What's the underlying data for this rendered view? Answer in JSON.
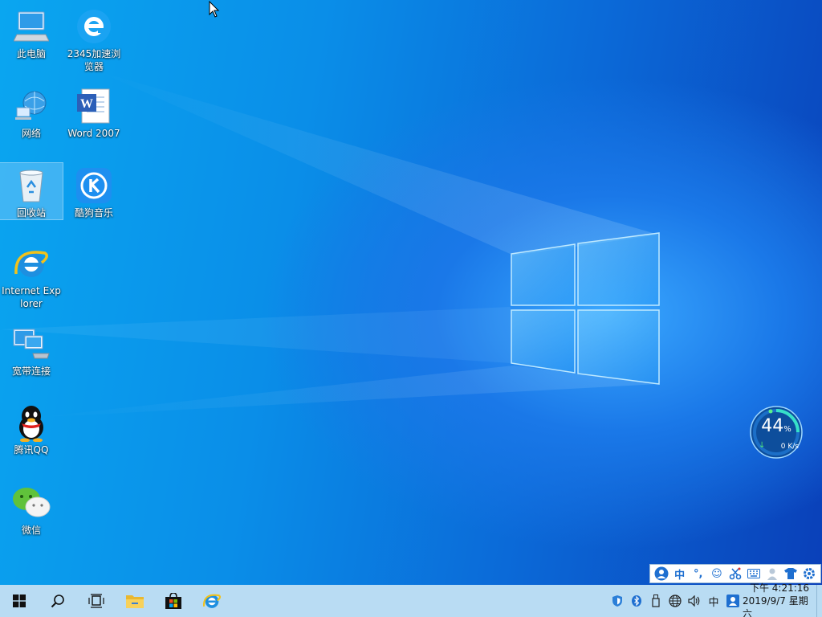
{
  "desktop": {
    "icons": [
      {
        "label": "此电脑",
        "icon": "computer-icon"
      },
      {
        "label": "2345加速浏览器",
        "icon": "browser-2345-icon"
      },
      {
        "label": "网络",
        "icon": "network-icon"
      },
      {
        "label": "Word 2007",
        "icon": "word-icon"
      },
      {
        "label": "回收站",
        "icon": "recycle-bin-icon"
      },
      {
        "label": "酷狗音乐",
        "icon": "kugou-icon"
      },
      {
        "label": "Internet Explorer",
        "icon": "ie-icon"
      },
      {
        "label": "宽带连接",
        "icon": "broadband-icon"
      },
      {
        "label": "腾讯QQ",
        "icon": "qq-icon"
      },
      {
        "label": "微信",
        "icon": "wechat-icon"
      }
    ]
  },
  "speed_widget": {
    "percent": "44",
    "percent_unit": "%",
    "rate": "0 K/s"
  },
  "ime_bar": {
    "lang": "中",
    "punct": "°,",
    "icons": [
      "user-icon",
      "chinese-mode-icon",
      "punctuation-icon",
      "emoji-icon",
      "scissors-icon",
      "keyboard-icon",
      "person-icon",
      "shirt-icon",
      "settings-icon"
    ]
  },
  "taskbar": {
    "pinned": [
      "start-icon",
      "search-icon",
      "task-view-icon",
      "file-explorer-icon",
      "store-icon",
      "ie-icon"
    ],
    "tray": {
      "lang": "中",
      "icons": [
        "security-icon",
        "bluetooth-icon",
        "usb-icon",
        "network-icon",
        "volume-icon",
        "ime-icon",
        "qq-tray-icon"
      ]
    },
    "clock": {
      "time": "下午 4:21:16",
      "date": "2019/9/7 星期六"
    }
  },
  "colors": {
    "taskbar": "#b9dcf3",
    "accent": "#1e6fd0"
  }
}
